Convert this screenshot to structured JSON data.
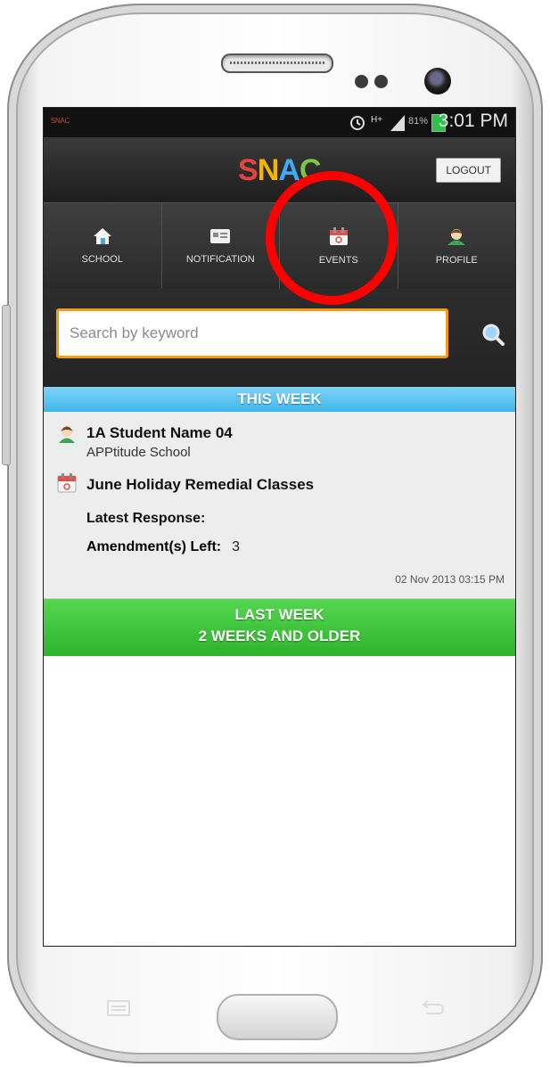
{
  "status_bar": {
    "app_label": "SNAC",
    "battery_percent": "81%",
    "time": "3:01 PM",
    "network": "H+"
  },
  "header": {
    "logo_letters": [
      {
        "char": "S",
        "color": "#e8423a"
      },
      {
        "char": "N",
        "color": "#f4b400"
      },
      {
        "char": "A",
        "color": "#3fa9f5"
      },
      {
        "char": "C",
        "color": "#7ac943"
      }
    ],
    "logout_label": "LOGOUT"
  },
  "tabs": [
    {
      "label": "SCHOOL",
      "icon": "house-icon"
    },
    {
      "label": "NOTIFICATION",
      "icon": "notification-icon"
    },
    {
      "label": "EVENTS",
      "icon": "calendar-icon"
    },
    {
      "label": "PROFILE",
      "icon": "profile-icon"
    }
  ],
  "search": {
    "placeholder": "Search by keyword",
    "icon": "search-icon"
  },
  "sections": {
    "this_week": "THIS WEEK",
    "last_week": "LAST WEEK",
    "older": "2 WEEKS AND OLDER"
  },
  "entry": {
    "student_name": "1A Student Name 04",
    "school": "APPtitude School",
    "event_title": "June Holiday Remedial Classes",
    "latest_response_label": "Latest Response:",
    "amendments_label": "Amendment(s) Left:",
    "amendments_value": "3",
    "timestamp": "02 Nov 2013 03:15 PM"
  },
  "colors": {
    "accent_search_border": "#f39c12",
    "this_week_bar": "#3fb6ec",
    "older_bar": "#2fb22c",
    "highlight_circle": "#ff0000"
  }
}
